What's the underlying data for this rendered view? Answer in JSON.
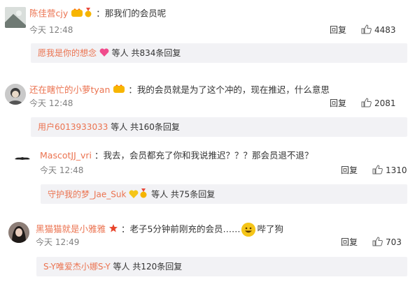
{
  "comments": [
    {
      "username": "陈佳营cjy",
      "text": "：那我们的会员呢",
      "time": "今天 12:48",
      "reply_label": "回复",
      "likes": "4483",
      "sub": {
        "user": "愿我是你的想念",
        "tail": "等人 共834条回复"
      }
    },
    {
      "username": "还在瞎忙的小萝tyan",
      "text": "：我的会员就是为了这个冲的，现在推迟，什么意思",
      "time": "今天 12:48",
      "reply_label": "回复",
      "likes": "2081",
      "sub": {
        "user": "用户6013933033",
        "tail": "等人 共160条回复"
      }
    },
    {
      "username": "MascotJJ_vri",
      "text": "：我去，会员都充了你和我说推迟？？？那会员退不退？",
      "time": "今天 12:48",
      "reply_label": "回复",
      "likes": "1310",
      "sub": {
        "user": "守护我的梦_Jae_Suk",
        "tail": "等人 共75条回复"
      }
    },
    {
      "username": "黑猫猫就是小雅雅",
      "text": "：老子5分钟前刚充的会员……",
      "text_after": "哔了狗",
      "time": "今天 12:49",
      "reply_label": "回复",
      "likes": "703",
      "sub": {
        "user": "S-Y唯爱杰小娜S-Y",
        "tail": "等人 共120条回复"
      }
    }
  ],
  "colors": {
    "username": "#eb7350",
    "muted": "#808080",
    "subbox_bg": "#f2f2f5"
  },
  "icons": [
    "avatar",
    "vip-badge-icon",
    "medal-icon",
    "heart-icon",
    "thumbs-up-icon",
    "grin-emoji-icon",
    "star-icon"
  ]
}
